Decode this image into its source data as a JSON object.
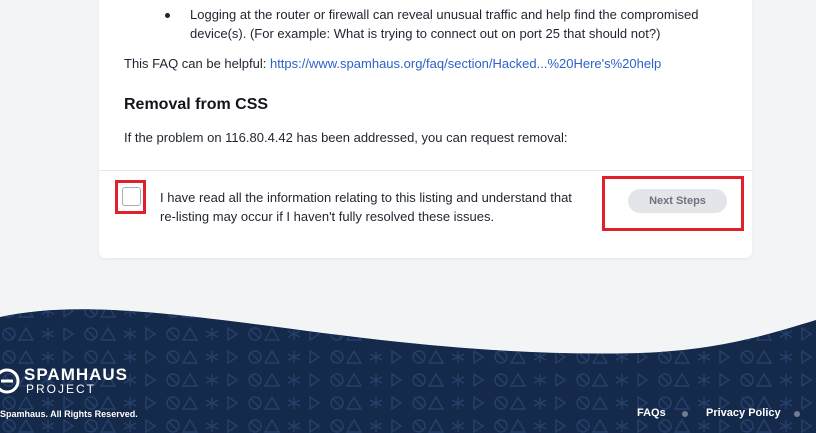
{
  "content": {
    "bullet_text": "Logging at the router or firewall can reveal unusual traffic and help find the compromised device(s). (For example: What is trying to connect out on port 25 that should not?)",
    "faq_prefix": "This FAQ can be helpful: ",
    "faq_link": "https://www.spamhaus.org/faq/section/Hacked...%20Here's%20help",
    "removal_heading": "Removal from CSS",
    "removal_text": "If the problem on 116.80.4.42 has been addressed, you can request removal:",
    "checkbox_checked": false,
    "checkbox_label": "I have read all the information relating to this listing and understand that re-listing may occur if I haven't fully resolved these issues.",
    "next_button": "Next Steps"
  },
  "footer": {
    "logo_title": "SPAMHAUS",
    "logo_subtitle": "PROJECT",
    "copyright": "Spamhaus. All Rights Reserved.",
    "links": [
      "FAQs",
      "Privacy Policy"
    ]
  },
  "colors": {
    "footer_bg": "#15294a",
    "highlight": "#e0202a",
    "link": "#2c62c9",
    "button_bg": "#e3e5e9"
  }
}
